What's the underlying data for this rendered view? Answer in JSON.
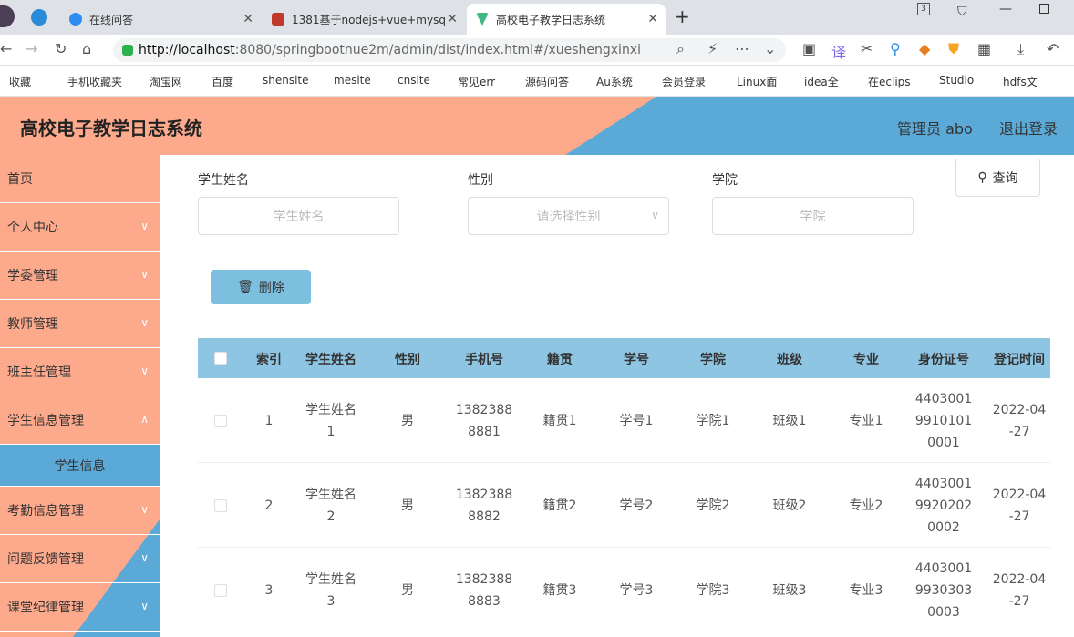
{
  "browser": {
    "tabs": [
      {
        "label": "在线问答",
        "active": false
      },
      {
        "label": "1381基于nodejs+vue+mysq",
        "active": false
      },
      {
        "label": "高校电子教学日志系统",
        "active": true
      }
    ],
    "new_tab": "+",
    "tab_count": "3",
    "url_host": "http://localhost",
    "url_rest": ":8080/springbootnue2m/admin/dist/index.html#/xueshengxinxi",
    "bookmarks": [
      "收藏",
      "手机收藏夹",
      "淘宝网",
      "百度",
      "shensite",
      "mesite",
      "cnsite",
      "常见err",
      "源码问答",
      "Au系统",
      "会员登录",
      "Linux面",
      "idea全",
      "在eclips",
      "Studio",
      "hdfs文"
    ]
  },
  "header": {
    "title": "高校电子教学日志系统",
    "user": "管理员 abo",
    "logout": "退出登录"
  },
  "sidebar": {
    "items": [
      {
        "label": "首页",
        "chevron": false
      },
      {
        "label": "个人中心",
        "chevron": true
      },
      {
        "label": "学委管理",
        "chevron": true
      },
      {
        "label": "教师管理",
        "chevron": true
      },
      {
        "label": "班主任管理",
        "chevron": true
      },
      {
        "label": "学生信息管理",
        "chevron": true
      },
      {
        "label": "学生信息",
        "sub": true
      },
      {
        "label": "考勤信息管理",
        "chevron": true
      },
      {
        "label": "问题反馈管理",
        "chevron": true
      },
      {
        "label": "课堂纪律管理",
        "chevron": true
      }
    ]
  },
  "search": {
    "name_label": "学生姓名",
    "name_placeholder": "学生姓名",
    "gender_label": "性别",
    "gender_placeholder": "请选择性别",
    "college_label": "学院",
    "college_placeholder": "学院",
    "query_label": "查询"
  },
  "actions": {
    "delete_label": "删除"
  },
  "table": {
    "headers": [
      "索引",
      "学生姓名",
      "性别",
      "手机号",
      "籍贯",
      "学号",
      "学院",
      "班级",
      "专业",
      "身份证号",
      "登记时间"
    ],
    "rows": [
      {
        "index": "1",
        "name": [
          "学生姓名",
          "1"
        ],
        "gender": "男",
        "phone": [
          "1382388",
          "8881"
        ],
        "origin": "籍贯1",
        "sid": "学号1",
        "college": "学院1",
        "class": "班级1",
        "major": "专业1",
        "idcard": [
          "4403001",
          "9910101",
          "0001"
        ],
        "date": [
          "2022-04",
          "-27"
        ]
      },
      {
        "index": "2",
        "name": [
          "学生姓名",
          "2"
        ],
        "gender": "男",
        "phone": [
          "1382388",
          "8882"
        ],
        "origin": "籍贯2",
        "sid": "学号2",
        "college": "学院2",
        "class": "班级2",
        "major": "专业2",
        "idcard": [
          "4403001",
          "9920202",
          "0002"
        ],
        "date": [
          "2022-04",
          "-27"
        ]
      },
      {
        "index": "3",
        "name": [
          "学生姓名",
          "3"
        ],
        "gender": "男",
        "phone": [
          "1382388",
          "8883"
        ],
        "origin": "籍贯3",
        "sid": "学号3",
        "college": "学院3",
        "class": "班级3",
        "major": "专业3",
        "idcard": [
          "4403001",
          "9930303",
          "0003"
        ],
        "date": [
          "2022-04",
          "-27"
        ]
      }
    ]
  },
  "colors": {
    "accent": "#fda98c",
    "blue": "#5aa9d6",
    "table_head": "#8ec5e2"
  }
}
